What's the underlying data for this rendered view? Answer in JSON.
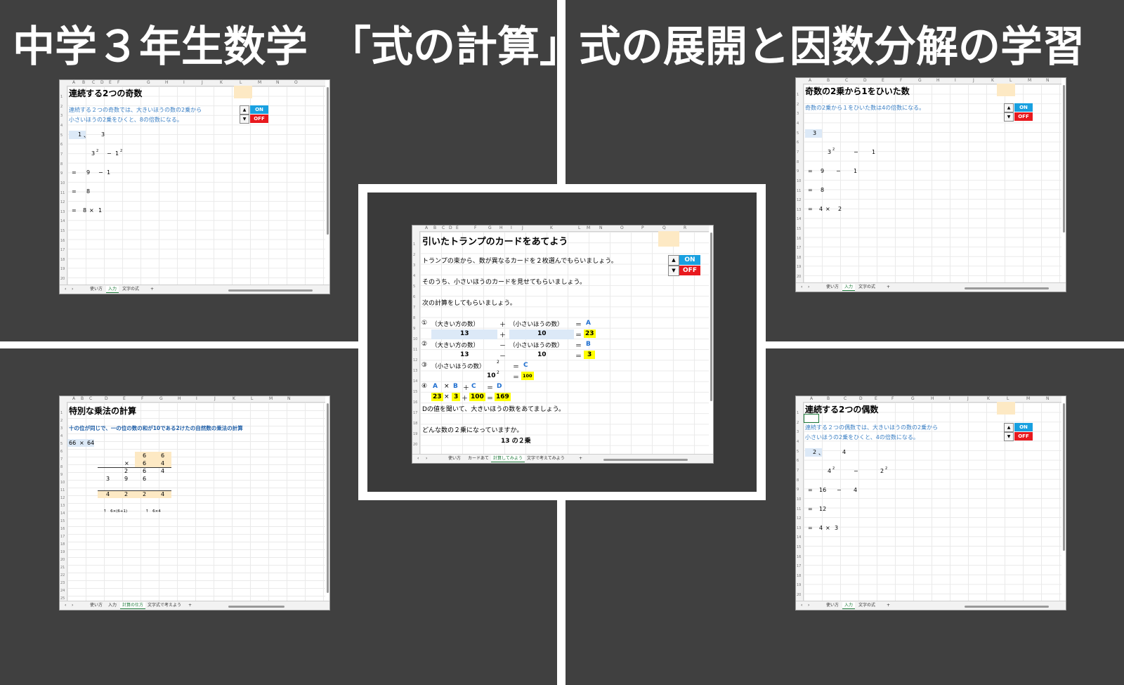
{
  "title": {
    "left": "中学３年生数学　「式の計算」",
    "right": "式の展開と因数分解の学習"
  },
  "tabs_common": {
    "prev": "‹",
    "next": "›",
    "add": "+"
  },
  "sheet_tl": {
    "heading": "連続する2つの奇数",
    "desc1": "連続する２つの奇数では、大きいほうの数の2乗から",
    "desc2": "小さいほうの2乗をひくと、8の倍数になる。",
    "on": "ON",
    "off": "OFF",
    "r6a": "1",
    "r6b": "、",
    "r6c": "3",
    "r8a": "3",
    "r8sup": "2",
    "r8op": "−",
    "r8b": "1",
    "r8sup2": "2",
    "r10eq": "=",
    "r10a": "9",
    "r10op": "−",
    "r10b": "1",
    "r12eq": "=",
    "r12a": "8",
    "r14eq": "=",
    "r14a": "8",
    "r14op": "×",
    "r14b": "1",
    "tabs": [
      "使い方",
      "入力",
      "文字の式"
    ]
  },
  "sheet_tr": {
    "heading": "奇数の2乗から1をひいた数",
    "desc1": "奇数の2乗から１をひいた数は4の倍数になる。",
    "on": "ON",
    "off": "OFF",
    "r6a": "3",
    "r8a": "3",
    "r8sup": "2",
    "r8op": "−",
    "r8b": "1",
    "r10eq": "=",
    "r10a": "9",
    "r10op": "−",
    "r10b": "1",
    "r12eq": "=",
    "r12a": "8",
    "r14eq": "=",
    "r14a": "4",
    "r14op": "×",
    "r14b": "2",
    "tabs": [
      "使い方",
      "入力",
      "文字の式"
    ]
  },
  "sheet_bl": {
    "heading": "特別な乗法の計算",
    "desc1": "十の位が同じで、一の位の数の和が10である2けたの自然数の乗法の計算",
    "r5a": "66",
    "r5op": "×",
    "r5b": "64",
    "r7a": "6",
    "r7b": "6",
    "r8op": "×",
    "r8a": "6",
    "r8b": "4",
    "r9a": "2",
    "r9b": "6",
    "r9c": "4",
    "r10a": "3",
    "r10b": "9",
    "r10c": "6",
    "r11a": "4",
    "r11b": "2",
    "r11c": "2",
    "r11d": "4",
    "note1": "↑　6×(6+1)",
    "note2": "↑　6×4",
    "tabs": [
      "使い方",
      "入力",
      "計算の仕方",
      "文字式で考えよう"
    ]
  },
  "sheet_br": {
    "heading": "連続する2つの偶数",
    "desc1": "連続する２つの偶数では、大きいほうの数の2乗から",
    "desc2": "小さいほうの2乗をひくと、4の倍数になる。",
    "on": "ON",
    "off": "OFF",
    "r6a": "2",
    "r6b": "、",
    "r6c": "4",
    "r8a": "4",
    "r8sup": "2",
    "r8op": "−",
    "r8b": "2",
    "r8sup2": "2",
    "r10eq": "=",
    "r10a": "16",
    "r10op": "−",
    "r10b": "4",
    "r12eq": "=",
    "r12a": "12",
    "r14eq": "=",
    "r14a": "4",
    "r14op": "×",
    "r14b": "3",
    "tabs": [
      "使い方",
      "入力",
      "文字の式"
    ]
  },
  "sheet_center": {
    "heading": "引いたトランプのカードをあてよう",
    "line3": "トランプの束から、数が異なるカードを２枚選んでもらいましょう。",
    "line5": "そのうち、小さいほうのカードを見せてもらいましょう。",
    "line7": "次の計算をしてもらいましょう。",
    "on": "ON",
    "off": "OFF",
    "n1": "①",
    "big": "（大きい方の数）",
    "plus": "＋",
    "small": "（小さいほうの数）",
    "eq": "＝",
    "A": "A",
    "r10a": "13",
    "r10op": "＋",
    "r10b": "10",
    "r10eq": "＝",
    "r10r": "23",
    "n2": "②",
    "big2": "（大きい方の数）",
    "minus": "－",
    "small2": "（小さいほうの数）",
    "eq2": "＝",
    "B": "B",
    "r12a": "13",
    "r12op": "－",
    "r12b": "10",
    "r12eq": "＝",
    "r12r": "3",
    "n3": "③",
    "small3": "（小さいほうの数）",
    "sup": "2",
    "eq3": "＝",
    "C": "C",
    "r14a": "10",
    "r14sup": "2",
    "r14eq": "＝",
    "r14r": "100",
    "n4": "④",
    "r15A": "A",
    "r15x": "×",
    "r15B": "B",
    "r15p": "＋",
    "r15C": "C",
    "r15eq": "＝",
    "r15D": "D",
    "r16a": "23",
    "r16x": "×",
    "r16b": "3",
    "r16p": "＋",
    "r16c": "100",
    "r16eq": "＝",
    "r16r": "169",
    "line17": "Dの値を聞いて、大きいほうの数をあてましょう。",
    "line19": "どんな数の２乗になっていますか。",
    "line20": "13 の２乗",
    "tabs": [
      "使い方",
      "カードあて",
      "計算してみよう",
      "文字で考えてみよう"
    ]
  }
}
